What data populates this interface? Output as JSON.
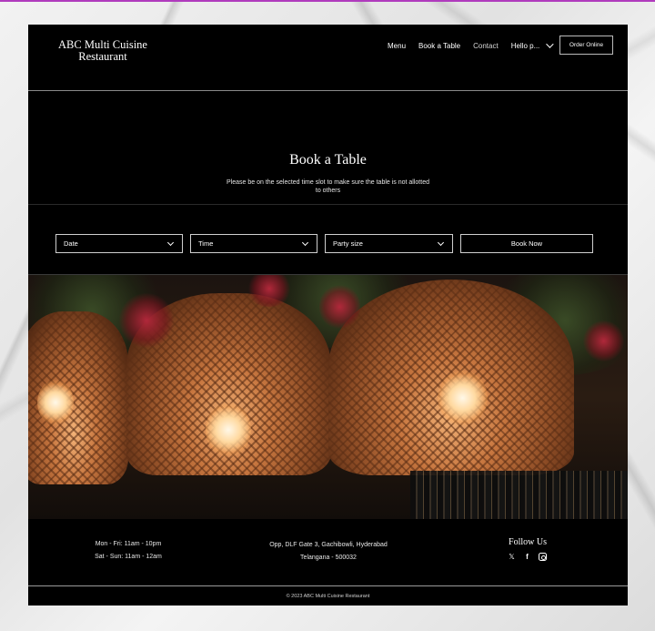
{
  "brand": {
    "name": "ABC Multi Cuisine Restaurant"
  },
  "nav": {
    "items": [
      "Menu",
      "Book a Table",
      "Contact"
    ],
    "user_label": "Hello p...",
    "order_button": "Order Online"
  },
  "hero": {
    "title": "Book a Table",
    "subtitle": "Please be on the selected time slot to make sure the table is not allotted to others"
  },
  "form": {
    "date_placeholder": "Date",
    "time_placeholder": "Time",
    "party_placeholder": "Party size",
    "submit": "Book Now"
  },
  "footer": {
    "hours": [
      "Mon - Fri: 11am - 10pm",
      "Sat - Sun: 11am - 12am"
    ],
    "address": [
      "Opp, DLF Gate 3, Gachibowli, Hyderabad",
      "Telangana - 500032"
    ],
    "follow_title": "Follow Us",
    "socials": [
      "twitter-icon",
      "facebook-icon",
      "instagram-icon"
    ],
    "copyright": "© 2023 ABC Multi Cuisine Restaurant"
  },
  "colors": {
    "background": "#000000",
    "accent_border": "#b03bbd"
  }
}
